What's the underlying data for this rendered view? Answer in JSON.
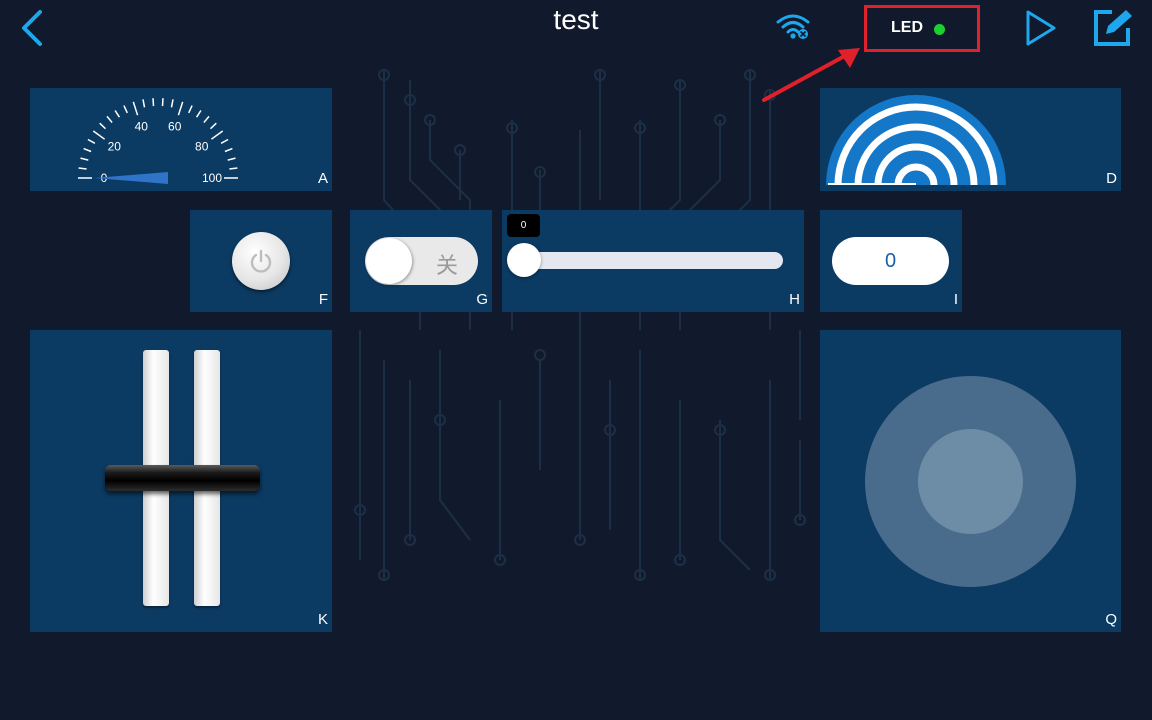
{
  "header": {
    "title": "test",
    "led_label": "LED",
    "led_color": "#19d22d"
  },
  "colors": {
    "accent": "#1ea7ec",
    "panel": "#0b3a62",
    "highlight": "#e0202a",
    "background": "#101a2c"
  },
  "widgets": {
    "gauge": {
      "label": "A",
      "ticks": [
        "0",
        "20",
        "40",
        "60",
        "80",
        "100"
      ],
      "value": 0
    },
    "radar": {
      "label": "D"
    },
    "power": {
      "label": "F"
    },
    "switch": {
      "label": "G",
      "state_text": "关",
      "on": false
    },
    "slider": {
      "label": "H",
      "value": "0"
    },
    "number": {
      "label": "I",
      "value": "0"
    },
    "fader": {
      "label": "K"
    },
    "joystick": {
      "label": "Q"
    }
  },
  "icons": {
    "back": "chevron-left-icon",
    "wifi": "wifi-disconnected-icon",
    "play": "play-icon",
    "edit": "edit-icon"
  }
}
